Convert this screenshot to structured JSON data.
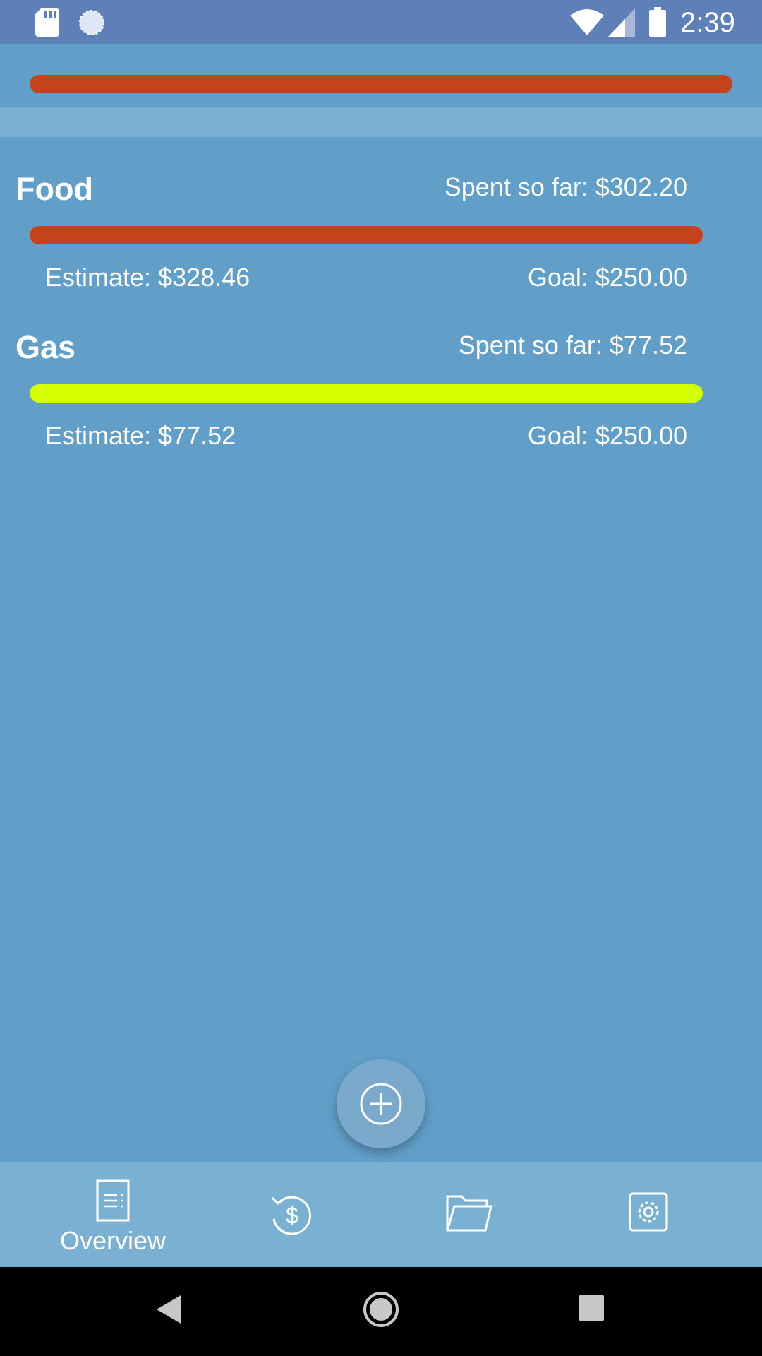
{
  "status_bar": {
    "time": "2:39",
    "icons": [
      "sd-card-icon",
      "sync-icon",
      "wifi-icon",
      "signal-icon",
      "battery-icon"
    ]
  },
  "overall": {
    "progress_fraction": 1.0,
    "bar_color": "#c5421b"
  },
  "categories": [
    {
      "name": "Food",
      "spent": "Spent so far: $302.20",
      "estimate": "Estimate: $328.46",
      "goal": "Goal: $250.00",
      "progress_fraction": 1.0,
      "bar_color": "#c5421b"
    },
    {
      "name": "Gas",
      "spent": "Spent so far: $77.52",
      "estimate": "Estimate: $77.52",
      "goal": "Goal: $250.00",
      "progress_fraction": 1.0,
      "bar_color": "#d4ff00"
    }
  ],
  "fab": {
    "icon": "plus-circle-icon"
  },
  "bottom_nav": {
    "items": [
      {
        "label": "Overview",
        "icon": "document-icon",
        "selected": true
      },
      {
        "icon": "history-dollar-icon"
      },
      {
        "icon": "folder-icon"
      },
      {
        "icon": "settings-gear-icon"
      }
    ]
  },
  "system_nav": {
    "icons": [
      "back-icon",
      "home-icon",
      "recents-icon"
    ]
  },
  "colors": {
    "background": "#619fc8",
    "status_bar": "#5f7fb8",
    "bottom_nav": "#7ab1d3"
  }
}
